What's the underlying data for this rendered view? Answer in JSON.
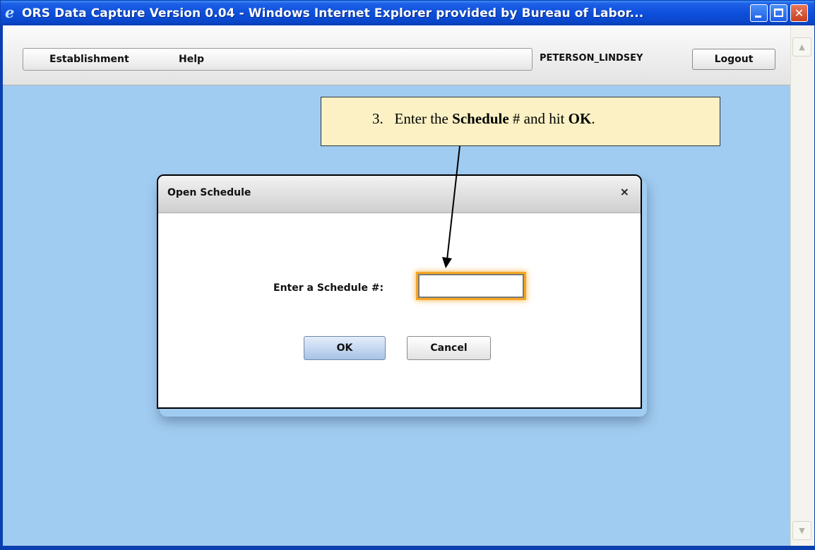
{
  "window": {
    "title": "ORS Data Capture Version 0.04 - Windows Internet Explorer provided by Bureau of Labor...",
    "minimize_glyph": "",
    "close_glyph": "✕",
    "accent_color": "#0a3fb0"
  },
  "header": {
    "menu": [
      "Establishment",
      "Help"
    ],
    "user": "PETERSON_LINDSEY",
    "logout_label": "Logout"
  },
  "callout": {
    "number": "3.",
    "text_before": "Enter the ",
    "bold1": "Schedule",
    "text_middle": " # and hit ",
    "bold2": "OK",
    "text_after": "."
  },
  "dialog": {
    "title": "Open Schedule",
    "close_glyph": "×",
    "field_label": "Enter a Schedule #:",
    "field_value": "",
    "ok_label": "OK",
    "cancel_label": "Cancel"
  },
  "scrollbar": {
    "up_glyph": "▲",
    "down_glyph": "▼"
  },
  "colors": {
    "page_background": "#a1ccf1",
    "callout_background": "#fbf1c4",
    "focus_glow": "#f5a623"
  }
}
